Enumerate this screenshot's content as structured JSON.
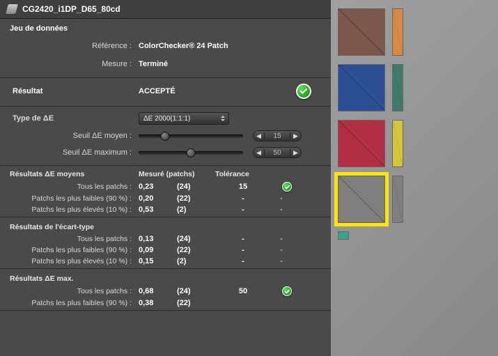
{
  "title": "CG2420_i1DP_D65_80cd",
  "dataset": {
    "header": "Jeu de données",
    "reference_label": "Référence :",
    "reference_value": "ColorChecker® 24 Patch",
    "measure_label": "Mesure :",
    "measure_value": "Terminé"
  },
  "result": {
    "label": "Résultat",
    "value": "ACCEPTÉ"
  },
  "deltaE_type": {
    "label": "Type de ΔE",
    "value": "ΔE 2000(1:1:1)"
  },
  "thresholds": {
    "mean_label": "Seuil ΔE moyen :",
    "mean_value": "15",
    "mean_percent": 25,
    "max_label": "Seuil ΔE maximum :",
    "max_value": "50",
    "max_percent": 50
  },
  "grid": {
    "col_measured": "Mesuré (patchs)",
    "col_tolerance": "Tolérance",
    "groups": [
      {
        "title": "Résultats ΔE moyens",
        "rows": [
          {
            "label": "Tous les patchs :",
            "meas": "0,23",
            "count": "(24)",
            "tol": "15",
            "ok": true
          },
          {
            "label": "Patchs les plus faibles (90 %) :",
            "meas": "0,20",
            "count": "(22)",
            "tol": "-",
            "ok": "-"
          },
          {
            "label": "Patchs les plus élevés (10 %) :",
            "meas": "0,53",
            "count": "(2)",
            "tol": "-",
            "ok": "-"
          }
        ]
      },
      {
        "title": "Résultats de l'écart-type",
        "rows": [
          {
            "label": "Tous les patchs :",
            "meas": "0,13",
            "count": "(24)",
            "tol": "-",
            "ok": "-"
          },
          {
            "label": "Patchs les plus faibles (90 %) :",
            "meas": "0,09",
            "count": "(22)",
            "tol": "-",
            "ok": "-"
          },
          {
            "label": "Patchs les plus élevés (10 %) :",
            "meas": "0,15",
            "count": "(2)",
            "tol": "-",
            "ok": "-"
          }
        ]
      },
      {
        "title": "Résultats ΔE max.",
        "rows": [
          {
            "label": "Tous les patchs :",
            "meas": "0,68",
            "count": "(24)",
            "tol": "50",
            "ok": true
          },
          {
            "label": "Patchs les plus faibles (90 %) :",
            "meas": "0,38",
            "count": "(22)",
            "tol": "",
            "ok": ""
          }
        ]
      }
    ]
  },
  "patches": [
    {
      "rows": [
        {
          "color": "#7a5748"
        },
        {
          "color": "#d88a43",
          "partial": true
        }
      ]
    },
    {
      "rows": [
        {
          "color": "#2b4f94"
        },
        {
          "color": "#3f7a6c",
          "partial": true
        }
      ]
    },
    {
      "rows": [
        {
          "color": "#b22e45"
        },
        {
          "color": "#d4c53a",
          "partial": true
        }
      ]
    },
    {
      "rows": [
        {
          "color": "#7f7f7f",
          "highlight": true
        },
        {
          "color": "#7f7f7f",
          "partial": true
        }
      ]
    },
    {
      "rows": [
        {
          "color": "#37a58c",
          "partial": true,
          "short": true
        }
      ]
    }
  ]
}
